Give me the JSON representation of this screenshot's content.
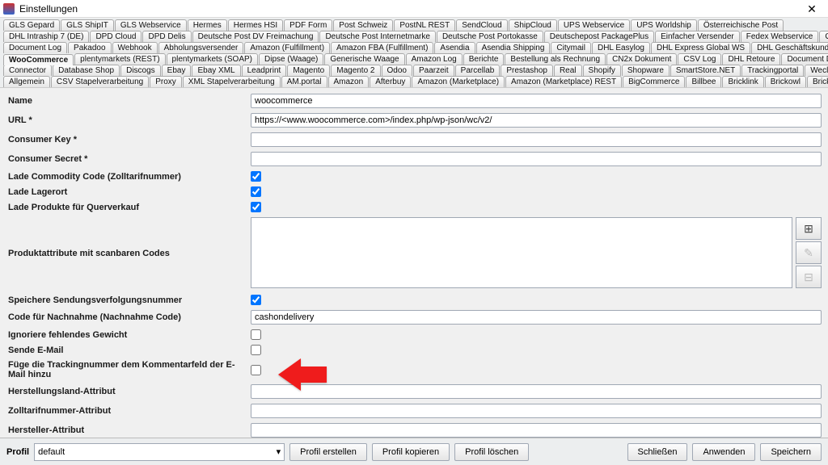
{
  "window": {
    "title": "Einstellungen"
  },
  "tabs": [
    [
      "GLS Gepard",
      "GLS ShipIT",
      "GLS Webservice",
      "Hermes",
      "Hermes HSI",
      "PDF Form",
      "Post Schweiz",
      "PostNL REST",
      "SendCloud",
      "ShipCloud",
      "UPS Webservice",
      "UPS Worldship",
      "Österreichische Post"
    ],
    [
      "DHL Intraship 7 (DE)",
      "DPD Cloud",
      "DPD Delis",
      "Deutsche Post DV Freimachung",
      "Deutsche Post Internetmarke",
      "Deutsche Post Portokasse",
      "Deutschepost PackagePlus",
      "Einfacher Versender",
      "Fedex Webservice",
      "GEL Express"
    ],
    [
      "Document Log",
      "Pakadoo",
      "Webhook",
      "Abholungsversender",
      "Amazon (Fulfillment)",
      "Amazon FBA (Fulfillment)",
      "Asendia",
      "Asendia Shipping",
      "Citymail",
      "DHL Easylog",
      "DHL Express Global WS",
      "DHL Geschäftskundenversand"
    ],
    [
      "WooCommerce",
      "plentymarkets (REST)",
      "plentymarkets (SOAP)",
      "Dipse (Waage)",
      "Generische Waage",
      "Amazon Log",
      "Berichte",
      "Bestellung als Rechnung",
      "CN2x Dokument",
      "CSV Log",
      "DHL Retoure",
      "Document Downloader"
    ],
    [
      "Connector",
      "Database Shop",
      "Discogs",
      "Ebay",
      "Ebay XML",
      "Leadprint",
      "Magento",
      "Magento 2",
      "Odoo",
      "Paarzeit",
      "Parcellab",
      "Prestashop",
      "Real",
      "Shopify",
      "Shopware",
      "SmartStore.NET",
      "Trackingportal",
      "Weclapp"
    ],
    [
      "Allgemein",
      "CSV Stapelverarbeitung",
      "Proxy",
      "XML Stapelverarbeitung",
      "AM.portal",
      "Amazon",
      "Afterbuy",
      "Amazon (Marketplace)",
      "Amazon (Marketplace) REST",
      "BigCommerce",
      "Billbee",
      "Bricklink",
      "Brickowl",
      "Brickscout"
    ]
  ],
  "activeTab": "WooCommerce",
  "form": {
    "name": {
      "label": "Name",
      "value": "woocommerce"
    },
    "url": {
      "label": "URL *",
      "value": "https://<www.woocommerce.com>/index.php/wp-json/wc/v2/"
    },
    "ckey": {
      "label": "Consumer Key *",
      "value": ""
    },
    "csecret": {
      "label": "Consumer Secret *",
      "value": ""
    },
    "commodity": {
      "label": "Lade Commodity Code (Zolltarifnummer)",
      "checked": true
    },
    "lagerort": {
      "label": "Lade Lagerort",
      "checked": true
    },
    "querverkauf": {
      "label": "Lade Produkte für Querverkauf",
      "checked": true
    },
    "attrs": {
      "label": "Produktattribute mit scanbaren Codes"
    },
    "tracking": {
      "label": "Speichere Sendungsverfolgungsnummer",
      "checked": true
    },
    "cod": {
      "label": "Code für Nachnahme (Nachnahme Code)",
      "value": "cashondelivery"
    },
    "ignoreweight": {
      "label": "Ignoriere fehlendes Gewicht",
      "checked": false
    },
    "sendmail": {
      "label": "Sende E-Mail",
      "checked": false
    },
    "trackmail": {
      "label": "Füge die Trackingnummer dem Kommentarfeld der E-Mail hinzu",
      "checked": false
    },
    "origin": {
      "label": "Herstellungsland-Attribut",
      "value": ""
    },
    "tariff": {
      "label": "Zolltarifnummer-Attribut",
      "value": ""
    },
    "maker": {
      "label": "Hersteller-Attribut",
      "value": ""
    }
  },
  "bottom": {
    "profileLabel": "Profil",
    "profileValue": "default",
    "create": "Profil erstellen",
    "copy": "Profil kopieren",
    "delete": "Profil löschen",
    "close": "Schließen",
    "apply": "Anwenden",
    "save": "Speichern"
  }
}
